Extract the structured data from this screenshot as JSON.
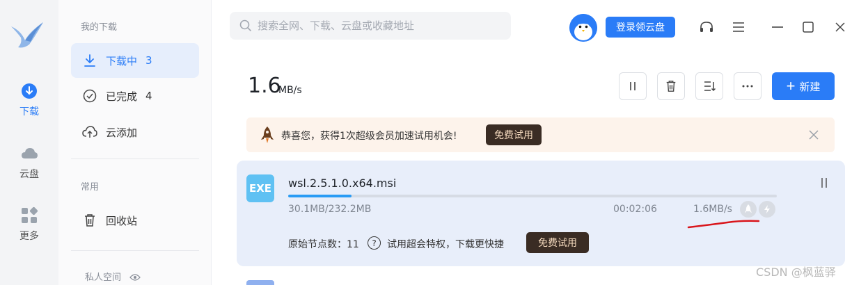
{
  "rail": {
    "items": [
      {
        "label": "下载",
        "icon": "download-circle-icon"
      },
      {
        "label": "云盘",
        "icon": "cloud-icon"
      },
      {
        "label": "更多",
        "icon": "apps-grid-icon"
      }
    ]
  },
  "sidebar": {
    "section_downloads": "我的下载",
    "items": [
      {
        "label": "下载中",
        "count": "3",
        "icon": "download-arrow-icon"
      },
      {
        "label": "已完成",
        "count": "4",
        "icon": "check-circle-icon"
      },
      {
        "label": "云添加",
        "icon": "cloud-upload-icon"
      }
    ],
    "section_common": "常用",
    "recycle": {
      "label": "回收站",
      "icon": "trash-icon"
    },
    "section_private": "私人空间"
  },
  "topbar": {
    "search_placeholder": "搜索全网、下载、云盘或收藏地址",
    "login_label": "登录领云盘"
  },
  "toolbar": {
    "speed_value": "1.6",
    "speed_unit": "MB/s",
    "new_label": "新建"
  },
  "promo": {
    "text": "恭喜您，获得1次超级会员加速试用机会!",
    "button": "免费试用"
  },
  "task": {
    "badge": "EXE",
    "filename": "wsl.2.5.1.0.x64.msi",
    "progress": 0.13,
    "size_text": "30.1MB/232.2MB",
    "time_left": "00:02:06",
    "speed": "1.6MB/s",
    "nodes_text": "原始节点数：11",
    "privilege_text": "试用超会特权，下载更快捷",
    "button": "免费试用"
  },
  "watermark": "CSDN @枫蓝驿",
  "colors": {
    "accent": "#2a7cf7",
    "dark_btn": "#3a2c24",
    "card_bg": "#e8eefa",
    "promo_bg": "#fdf3eb"
  }
}
